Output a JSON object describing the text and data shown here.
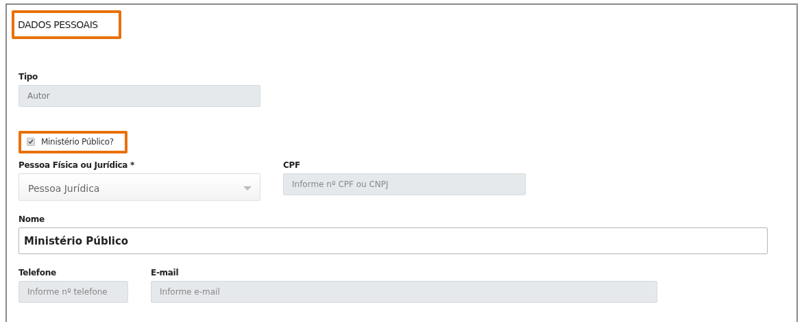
{
  "section": {
    "title": "DADOS PESSOAIS"
  },
  "tipo": {
    "label": "Tipo",
    "value": "Autor",
    "disabled": true
  },
  "ministerio": {
    "label": "Ministério Público?",
    "checked": true,
    "disabled": true
  },
  "pessoa": {
    "label": "Pessoa Física ou Jurídica *",
    "value": "Pessoa Jurídica",
    "disabled": true
  },
  "cpf": {
    "label": "CPF",
    "placeholder": "Informe nº CPF ou CNPJ",
    "disabled": true
  },
  "nome": {
    "label": "Nome",
    "value": "Ministério Público",
    "disabled": false
  },
  "telefone": {
    "label": "Telefone",
    "placeholder": "Informe nº telefone",
    "disabled": true
  },
  "email": {
    "label": "E-mail",
    "placeholder": "Informe e-mail",
    "disabled": true
  }
}
